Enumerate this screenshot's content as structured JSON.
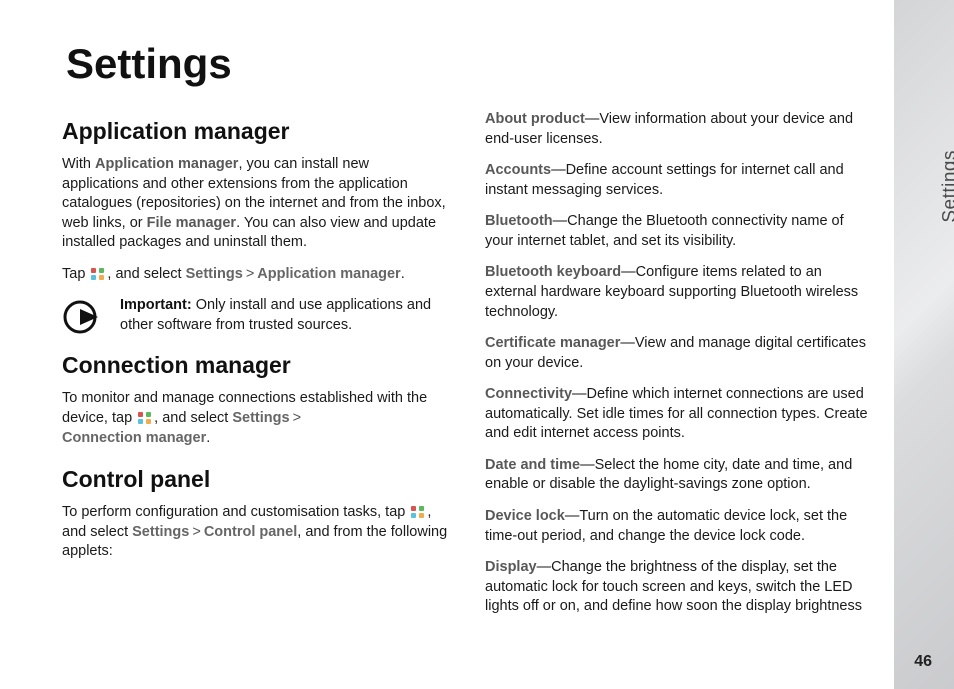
{
  "sideTab": "Settings",
  "pageNumber": "46",
  "title": "Settings",
  "left": {
    "h2a": "Application manager",
    "p1_a": "With ",
    "p1_b": "Application manager",
    "p1_c": ", you can install new applications and other extensions from the application catalogues (repositories) on the internet and from the inbox, web links, or ",
    "p1_d": "File manager",
    "p1_e": ". You can also view and update installed packages and uninstall them.",
    "p2_a": "Tap ",
    "p2_b": ", and select ",
    "p2_c": "Settings",
    "p2_d": "Application manager",
    "p2_end": ".",
    "imp_a": "Important:",
    "imp_b": " Only install and use applications and other software from trusted sources.",
    "h2b": "Connection manager",
    "p3_a": "To monitor and manage connections established with the device, tap ",
    "p3_b": ", and select ",
    "p3_c": "Settings",
    "p3_d": "Connection manager",
    "p3_end": ".",
    "h2c": "Control panel",
    "p4_a": "To perform configuration and customisation tasks, tap ",
    "p4_b": ", and select ",
    "p4_c": "Settings",
    "p4_d": "Control panel",
    "p4_e": ", and from the following applets:"
  },
  "entries": [
    {
      "label": "About product",
      "desc": "—View information about your device and end-user licenses."
    },
    {
      "label": "Accounts",
      "desc": "—Define account settings for internet call and instant messaging services."
    },
    {
      "label": "Bluetooth",
      "desc": "—Change the Bluetooth connectivity name of your internet tablet, and set its visibility."
    },
    {
      "label": "Bluetooth keyboard",
      "desc": "—Configure items related to an external hardware keyboard supporting Bluetooth wireless technology."
    },
    {
      "label": "Certificate manager",
      "desc": "—View and manage digital certificates on your device."
    },
    {
      "label": "Connectivity",
      "desc": "—Define which internet connections are used automatically. Set idle times for all connection types. Create and edit internet access points."
    },
    {
      "label": "Date and time",
      "desc": "—Select the home city, date and time, and enable or disable the daylight-savings zone option."
    },
    {
      "label": "Device lock",
      "desc": "—Turn on the automatic device lock, set the time-out period, and change the device lock code."
    },
    {
      "label": "Display",
      "desc": "—Change the brightness of the display, set the automatic lock for touch screen and keys, switch the LED lights off or on, and define how soon the display brightness"
    }
  ]
}
